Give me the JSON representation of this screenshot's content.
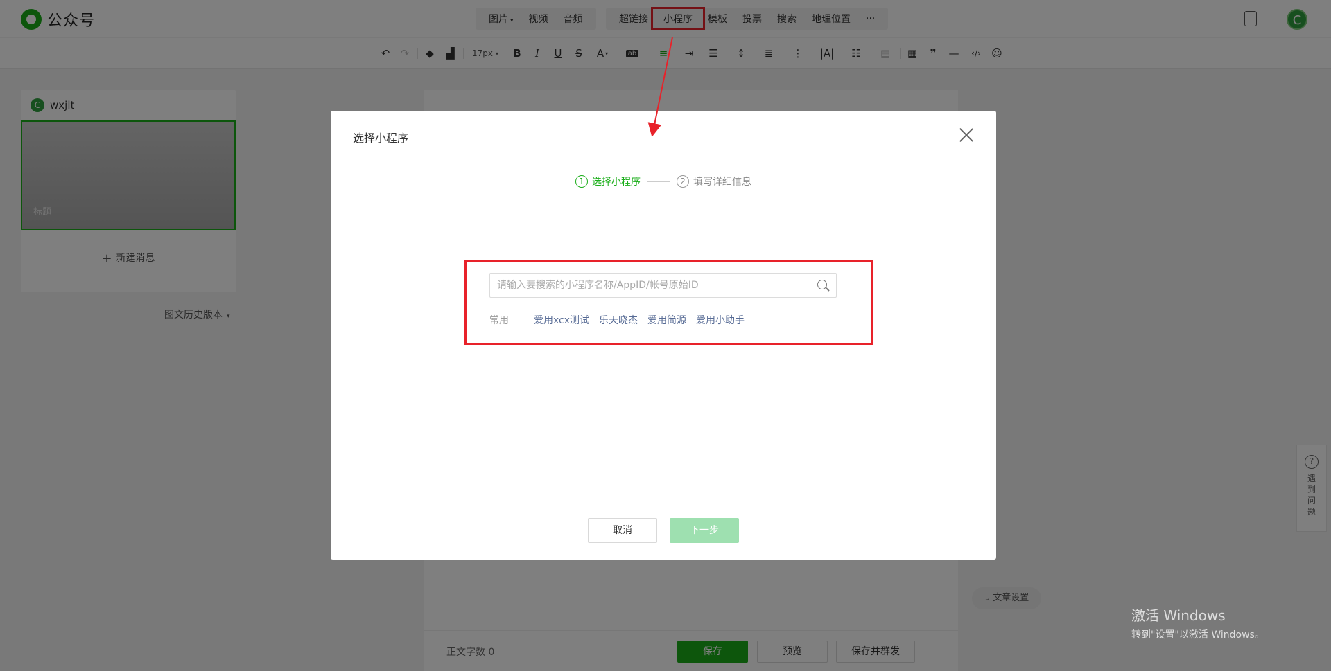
{
  "app": {
    "name": "公众号"
  },
  "topbar": {
    "insert_items": [
      {
        "label": "图片",
        "has_caret": true
      },
      {
        "label": "视频"
      },
      {
        "label": "音频"
      }
    ],
    "insert_items_2": [
      {
        "label": "超链接"
      },
      {
        "label": "小程序",
        "highlighted": true
      },
      {
        "label": "模板"
      },
      {
        "label": "投票"
      },
      {
        "label": "搜索"
      },
      {
        "label": "地理位置"
      },
      {
        "label": "···"
      }
    ],
    "avatar_letter": "C"
  },
  "toolbar": {
    "font_size": "17px",
    "bold": "B",
    "italic": "I",
    "underline": "U",
    "strike": "S",
    "font_color": "A"
  },
  "left_panel": {
    "account_name": "wxjlt",
    "avatar_letter": "C",
    "cover_title": "标题",
    "new_message": "新建消息",
    "history": "图文历史版本"
  },
  "editor": {
    "word_count_label": "正文字数",
    "word_count": "0",
    "save": "保存",
    "preview": "预览",
    "save_publish": "保存并群发",
    "article_settings": "文章设置"
  },
  "help": {
    "text": "遇到问题"
  },
  "watermark": {
    "line1": "激活 Windows",
    "line2": "转到\"设置\"以激活 Windows。"
  },
  "dialog": {
    "title": "选择小程序",
    "steps": [
      {
        "num": "1",
        "label": "选择小程序",
        "active": true
      },
      {
        "num": "2",
        "label": "填写详细信息",
        "active": false
      }
    ],
    "search": {
      "placeholder": "请输入要搜索的小程序名称/AppID/帐号原始ID",
      "value": ""
    },
    "frequent": {
      "label": "常用",
      "items": [
        "爱用xcx测试",
        "乐天晓杰",
        "爱用简源",
        "爱用小助手"
      ]
    },
    "cancel": "取消",
    "next": "下一步"
  },
  "colors": {
    "brand_green": "#1aad19",
    "link_blue": "#576b95",
    "annotation_red": "#e8222a",
    "next_disabled": "#9ee0b0"
  }
}
